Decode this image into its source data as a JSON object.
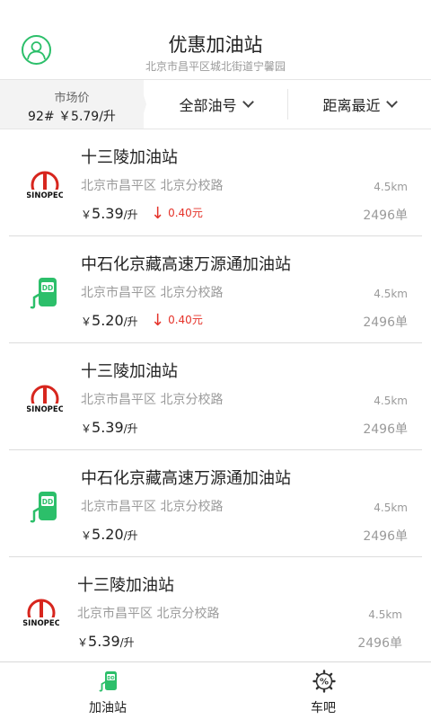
{
  "header": {
    "title": "优惠加油站",
    "subtitle": "北京市昌平区城北街道宁馨园"
  },
  "filters": {
    "market_label": "市场价",
    "market_value": "92# ￥5.79/升",
    "oil_type": "全部油号",
    "sort": "距离最近"
  },
  "stations": [
    {
      "logo": "sinopec-logo",
      "name": "十三陵加油站",
      "address": "北京市昌平区 北京分校路",
      "distance": "4.5km",
      "currency": "￥",
      "price": "5.39",
      "unit": "/升",
      "drop": "0.40元",
      "orders": "2496单"
    },
    {
      "logo": "dd-pump-logo",
      "name": "中石化京藏高速万源通加油站",
      "address": "北京市昌平区 北京分校路",
      "distance": "4.5km",
      "currency": "￥",
      "price": "5.20",
      "unit": "/升",
      "drop": "0.40元",
      "orders": "2496单"
    },
    {
      "logo": "sinopec-logo",
      "name": "十三陵加油站",
      "address": "北京市昌平区 北京分校路",
      "distance": "4.5km",
      "currency": "￥",
      "price": "5.39",
      "unit": "/升",
      "drop": "",
      "orders": "2496单"
    },
    {
      "logo": "dd-pump-logo",
      "name": "中石化京藏高速万源通加油站",
      "address": "北京市昌平区 北京分校路",
      "distance": "4.5km",
      "currency": "￥",
      "price": "5.20",
      "unit": "/升",
      "drop": "",
      "orders": "2496单"
    },
    {
      "logo": "sinopec-logo",
      "name": "十三陵加油站",
      "address": "北京市昌平区 北京分校路",
      "distance": "4.5km",
      "currency": "￥",
      "price": "5.39",
      "unit": "/升",
      "drop": "",
      "orders": "2496单"
    }
  ],
  "tabbar": {
    "tabs": [
      {
        "label": "加油站",
        "icon": "fuel-pump-icon"
      },
      {
        "label": "车吧",
        "icon": "discount-gear-icon"
      }
    ]
  },
  "colors": {
    "accent": "#2cbf6a",
    "price_drop": "#e5332a",
    "sinopec_red": "#d7261e"
  }
}
